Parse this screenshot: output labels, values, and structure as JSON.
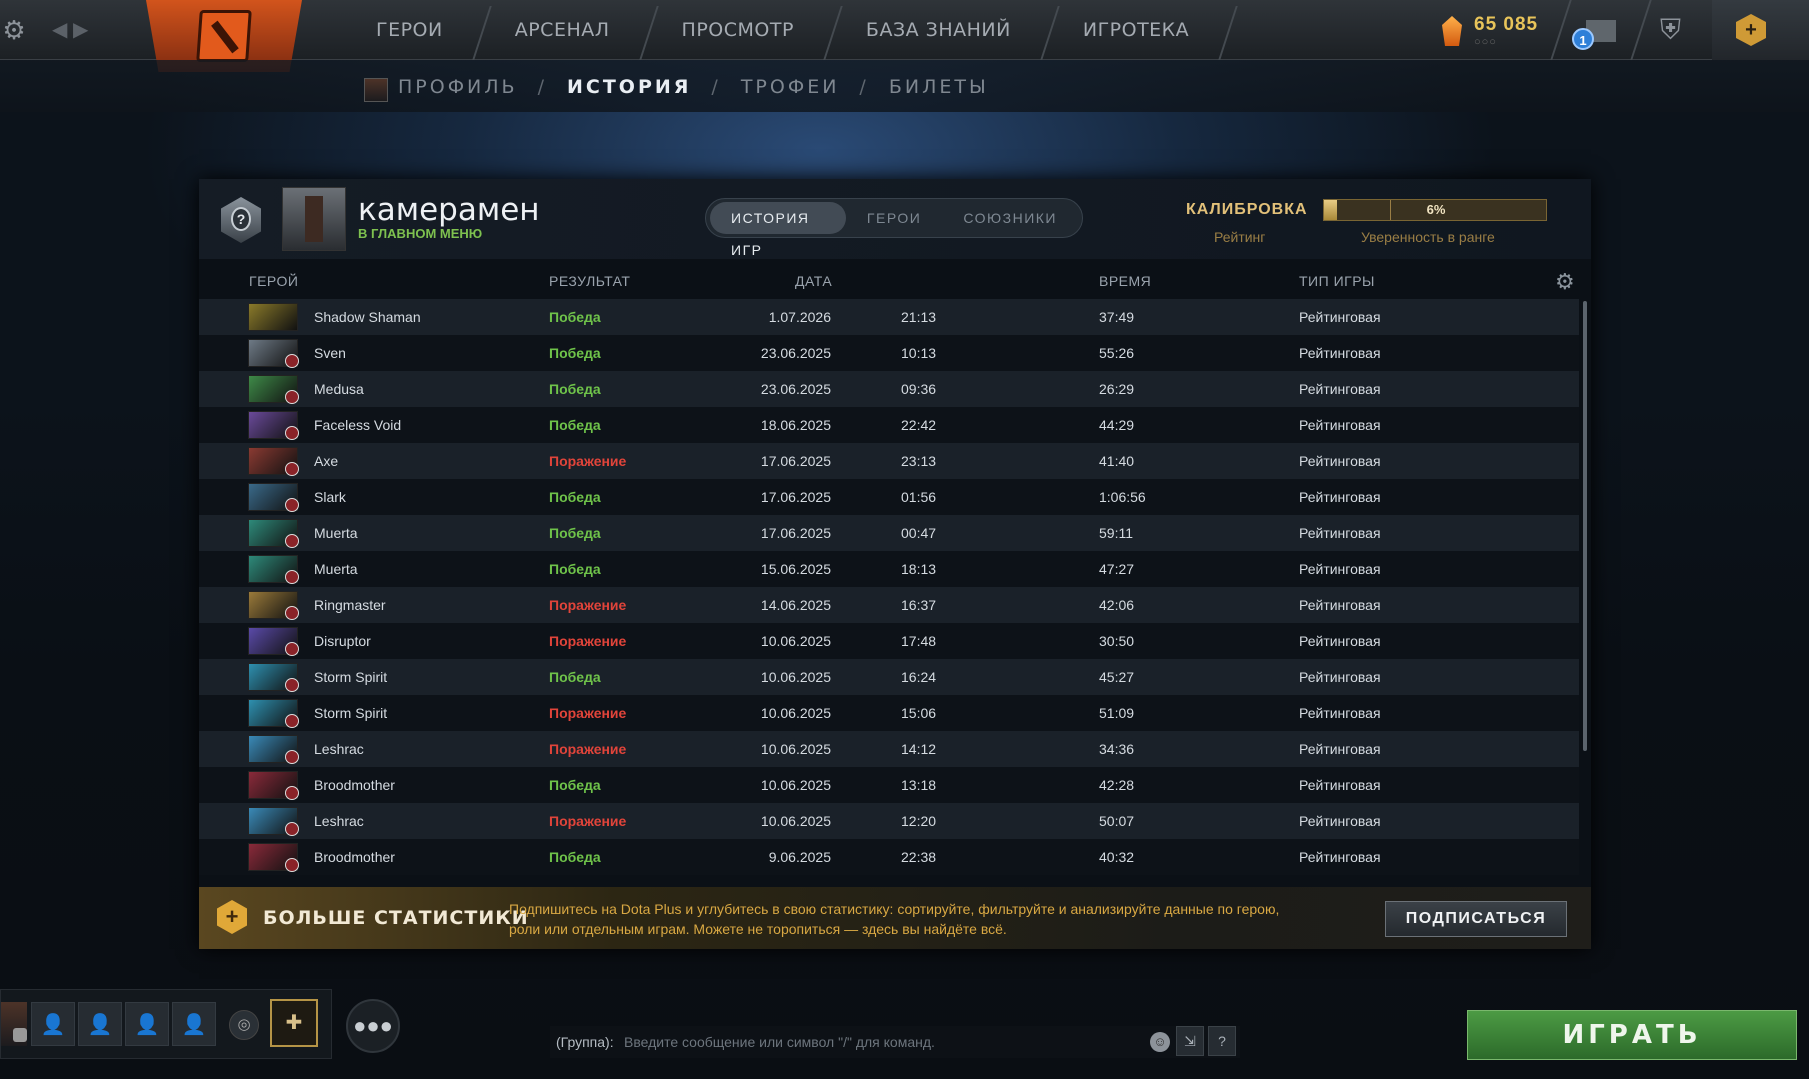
{
  "nav": {
    "items": [
      "ГЕРОИ",
      "АРСЕНАЛ",
      "ПРОСМОТР",
      "БАЗА ЗНАНИЙ",
      "ИГРОТЕКА"
    ],
    "shards": "65 085",
    "shards_dots": "○○○",
    "mail_count": "1"
  },
  "breadcrumb": {
    "items": [
      "ПРОФИЛЬ",
      "ИСТОРИЯ",
      "ТРОФЕИ",
      "БИЛЕТЫ"
    ],
    "active": "ИСТОРИЯ"
  },
  "profile": {
    "name": "камерамен",
    "status": "В ГЛАВНОМ МЕНЮ",
    "rank_icon": "?"
  },
  "tabs": [
    "ИСТОРИЯ ИГР",
    "ГЕРОИ",
    "СОЮЗНИКИ"
  ],
  "calibration": {
    "title": "КАЛИБРОВКА",
    "rating_label": "Рейтинг",
    "confidence_label": "Уверенность в ранге",
    "percent_text": "6%",
    "percent": 6
  },
  "table": {
    "headers": [
      "ГЕРОЙ",
      "РЕЗУЛЬТАТ",
      "ДАТА",
      "ВРЕМЯ",
      "ТИП ИГРЫ"
    ],
    "rows": [
      {
        "hero": "Shadow Shaman",
        "result": "Победа",
        "win": true,
        "date": "1.07.2026",
        "time": "21:13",
        "duration": "37:49",
        "type": "Рейтинговая",
        "color": "#8a7a2a",
        "badge": false
      },
      {
        "hero": "Sven",
        "result": "Победа",
        "win": true,
        "date": "23.06.2025",
        "time": "10:13",
        "duration": "55:26",
        "type": "Рейтинговая",
        "color": "#6e7a86",
        "badge": true
      },
      {
        "hero": "Medusa",
        "result": "Победа",
        "win": true,
        "date": "23.06.2025",
        "time": "09:36",
        "duration": "26:29",
        "type": "Рейтинговая",
        "color": "#3e8a48",
        "badge": true
      },
      {
        "hero": "Faceless Void",
        "result": "Победа",
        "win": true,
        "date": "18.06.2025",
        "time": "22:42",
        "duration": "44:29",
        "type": "Рейтинговая",
        "color": "#6a4a9a",
        "badge": true
      },
      {
        "hero": "Axe",
        "result": "Поражение",
        "win": false,
        "date": "17.06.2025",
        "time": "23:13",
        "duration": "41:40",
        "type": "Рейтинговая",
        "color": "#8a3a32",
        "badge": true
      },
      {
        "hero": "Slark",
        "result": "Победа",
        "win": true,
        "date": "17.06.2025",
        "time": "01:56",
        "duration": "1:06:56",
        "type": "Рейтинговая",
        "color": "#3a6a8a",
        "badge": true
      },
      {
        "hero": "Muerta",
        "result": "Победа",
        "win": true,
        "date": "17.06.2025",
        "time": "00:47",
        "duration": "59:11",
        "type": "Рейтинговая",
        "color": "#2e8a7a",
        "badge": true
      },
      {
        "hero": "Muerta",
        "result": "Победа",
        "win": true,
        "date": "15.06.2025",
        "time": "18:13",
        "duration": "47:27",
        "type": "Рейтинговая",
        "color": "#2e8a7a",
        "badge": true
      },
      {
        "hero": "Ringmaster",
        "result": "Поражение",
        "win": false,
        "date": "14.06.2025",
        "time": "16:37",
        "duration": "42:06",
        "type": "Рейтинговая",
        "color": "#9a7a3a",
        "badge": true
      },
      {
        "hero": "Disruptor",
        "result": "Поражение",
        "win": false,
        "date": "10.06.2025",
        "time": "17:48",
        "duration": "30:50",
        "type": "Рейтинговая",
        "color": "#5a4aa8",
        "badge": true
      },
      {
        "hero": "Storm Spirit",
        "result": "Победа",
        "win": true,
        "date": "10.06.2025",
        "time": "16:24",
        "duration": "45:27",
        "type": "Рейтинговая",
        "color": "#2e90b0",
        "badge": true
      },
      {
        "hero": "Storm Spirit",
        "result": "Поражение",
        "win": false,
        "date": "10.06.2025",
        "time": "15:06",
        "duration": "51:09",
        "type": "Рейтинговая",
        "color": "#2e90b0",
        "badge": true
      },
      {
        "hero": "Leshrac",
        "result": "Поражение",
        "win": false,
        "date": "10.06.2025",
        "time": "14:12",
        "duration": "34:36",
        "type": "Рейтинговая",
        "color": "#3a8ab8",
        "badge": true
      },
      {
        "hero": "Broodmother",
        "result": "Победа",
        "win": true,
        "date": "10.06.2025",
        "time": "13:18",
        "duration": "42:28",
        "type": "Рейтинговая",
        "color": "#8a2a3a",
        "badge": true
      },
      {
        "hero": "Leshrac",
        "result": "Поражение",
        "win": false,
        "date": "10.06.2025",
        "time": "12:20",
        "duration": "50:07",
        "type": "Рейтинговая",
        "color": "#3a8ab8",
        "badge": true
      },
      {
        "hero": "Broodmother",
        "result": "Победа",
        "win": true,
        "date": "9.06.2025",
        "time": "22:38",
        "duration": "40:32",
        "type": "Рейтинговая",
        "color": "#8a2a3a",
        "badge": true
      }
    ]
  },
  "promo": {
    "title": "БОЛЬШЕ СТАТИСТИКИ",
    "text": "Подпишитесь на Dota Plus и углубитесь в свою статистику: сортируйте, фильтруйте и анализируйте данные по герою, роли или отдельным играм. Можете не торопиться — здесь вы найдёте всё.",
    "button": "ПОДПИСАТЬСЯ"
  },
  "chat": {
    "label": "(Группа):",
    "placeholder": "Введите сообщение или символ \"/\" для команд."
  },
  "play_button": "ИГРАТЬ",
  "colors": {
    "win": "#6fc34a",
    "loss": "#e1443a",
    "gold": "#e2c079",
    "play": "#3e8a3a"
  }
}
